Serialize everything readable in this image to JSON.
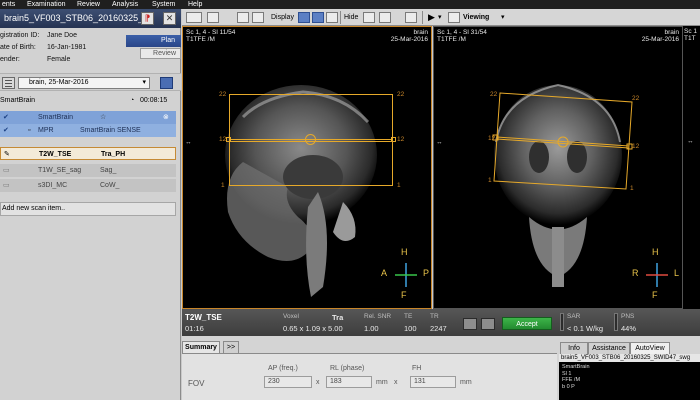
{
  "menu": [
    "ents",
    "Examination",
    "Review",
    "Analysis",
    "System",
    "Help"
  ],
  "left": {
    "title": "brain5_VF003_STB06_20160325_",
    "patient": {
      "labels": [
        "gistration ID:",
        "ate of Birth:",
        "ender:"
      ],
      "values": [
        "Jane Doe",
        "16-Jan-1981",
        "Female"
      ]
    },
    "plan_label": "Plan",
    "review_label": "Review",
    "exam_select": "brain, 25-Mar-2016",
    "smartbrain_label": "SmartBrain",
    "timer": "00:08:15",
    "scans": [
      {
        "col1": "SmartBrain",
        "col2": ""
      },
      {
        "col1": "MPR",
        "col2": "SmartBrain SENSE"
      },
      {
        "col1": "T2W_TSE",
        "col2": "Tra_PH"
      },
      {
        "col1": "T1W_SE_sag",
        "col2": "Sag_"
      },
      {
        "col1": "s3DI_MC",
        "col2": "CoW_"
      }
    ],
    "add_scan": "Add new scan item.."
  },
  "toolbar": {
    "display": "Display",
    "hide": "Hide",
    "viewing": "Viewing"
  },
  "viewports": [
    {
      "top_left": [
        "Sc 1, 4 - Sl 11/54",
        "T1TFE     /M"
      ],
      "top_right": [
        "brain",
        "25-Mar-2016"
      ],
      "orient": {
        "H": "H",
        "F": "F",
        "A": "A",
        "P": "P"
      },
      "numbers": {
        "tl": "22",
        "tr": "22",
        "ml": "12",
        "mr": "12",
        "bl": "1",
        "br": "1"
      }
    },
    {
      "top_left": [
        "Sc 1, 4 - Sl 31/54",
        "T1TFE     /M"
      ],
      "top_right": [
        "brain",
        "25-Mar-2016"
      ],
      "orient": {
        "H": "H",
        "F": "F",
        "R": "R",
        "L": "L"
      },
      "numbers": {
        "tl": "22",
        "tr": "22",
        "ml": "12",
        "mr": "12",
        "bl": "1",
        "br": "1"
      }
    }
  ],
  "strip": [
    "Sc 1",
    "T1T"
  ],
  "infobar": {
    "scan_name": "T2W_TSE",
    "duration": "01:16",
    "voxel_label": "Voxel",
    "voxel_value": "0.65 x 1.09 x 5.00",
    "orient_value": "Tra",
    "snr_label": "Rel. SNR",
    "snr_value": "1.00",
    "te_label": "TE",
    "te_value": "100",
    "tr_label": "TR",
    "tr_value": "2247",
    "accept": "Accept",
    "sar_label": "SAR",
    "sar_value": "< 0.1 W/kg",
    "pns_label": "PNS",
    "pns_value": "44%"
  },
  "tabs": {
    "summary": "Summary",
    "more": ">>",
    "info": "Info",
    "assistance": "Assistance",
    "autoview": "AutoView"
  },
  "params": {
    "fov_label": "FOV",
    "ap_label": "AP (freq.)",
    "rl_label": "RL (phase)",
    "fh_label": "FH",
    "ap_value": "230",
    "rl_value": "183",
    "fh_value": "131",
    "x": "x",
    "mm": "mm"
  },
  "autoview": {
    "title": "brain5_VF003_STB06_20160325_SWID47_swg",
    "lines": [
      "SmartBrain",
      "Sl 1",
      "FFE   /M",
      "b 0 P"
    ]
  },
  "colors": {
    "plan_box": "#e6a92a",
    "accent_blue": "#2a4688",
    "accept_green": "#2f9f3c",
    "selected_row": "#7fa2d8"
  }
}
